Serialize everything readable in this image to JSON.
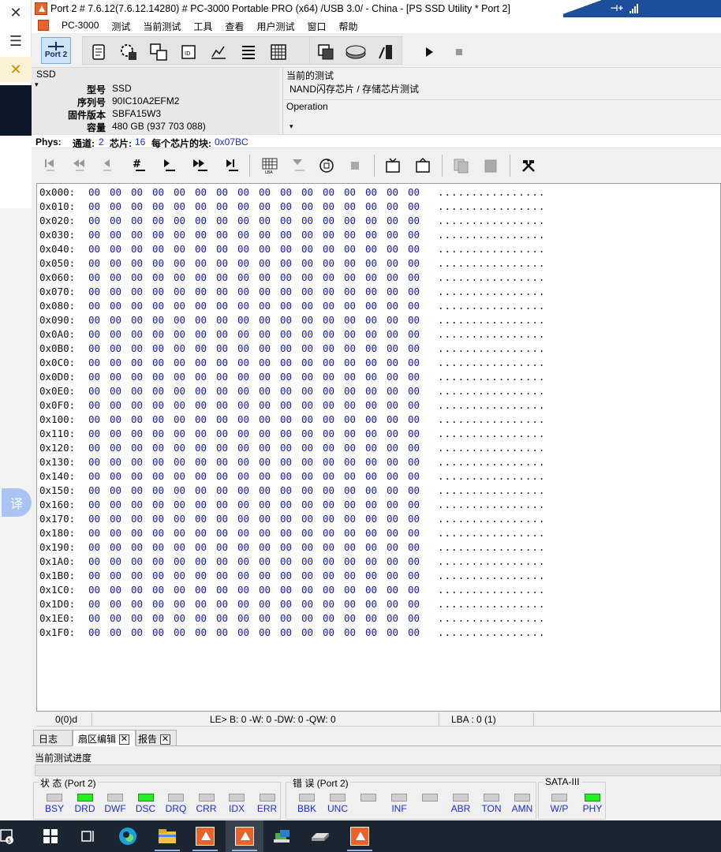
{
  "window": {
    "title": "Port 2 # 7.6.12(7.6.12.14280) # PC-3000 Portable PRO (x64) /USB 3.0/ - China - [PS SSD Utility * Port 2]"
  },
  "menu": {
    "items": [
      "PC-3000",
      "测试",
      "当前测试",
      "工具",
      "查看",
      "用户测试",
      "窗口",
      "帮助"
    ]
  },
  "toolbar": {
    "port_label": "Port 2"
  },
  "device": {
    "header": "SSD",
    "fields": [
      {
        "label": "型号",
        "value": "SSD"
      },
      {
        "label": "序列号",
        "value": "90IC10A2EFM2"
      },
      {
        "label": "固件版本",
        "value": "SBFA15W3"
      },
      {
        "label": "容量",
        "value": "480 GB (937 703 088)"
      }
    ]
  },
  "current_test": {
    "label": "当前的测试",
    "value": "NAND闪存芯片 / 存储芯片测试",
    "operation_label": "Operation"
  },
  "phys": {
    "label": "Phys:",
    "channels_label": "通道:",
    "channels": "2",
    "chips_label": "芯片:",
    "chips": "16",
    "blocks_label": "每个芯片的块:",
    "blocks": "0x07BC"
  },
  "hex": {
    "addresses": [
      "0x000:",
      "0x010:",
      "0x020:",
      "0x030:",
      "0x040:",
      "0x050:",
      "0x060:",
      "0x070:",
      "0x080:",
      "0x090:",
      "0x0A0:",
      "0x0B0:",
      "0x0C0:",
      "0x0D0:",
      "0x0E0:",
      "0x0F0:",
      "0x100:",
      "0x110:",
      "0x120:",
      "0x130:",
      "0x140:",
      "0x150:",
      "0x160:",
      "0x170:",
      "0x180:",
      "0x190:",
      "0x1A0:",
      "0x1B0:",
      "0x1C0:",
      "0x1D0:",
      "0x1E0:",
      "0x1F0:"
    ],
    "byte_value": "00",
    "bytes_per_row": 16,
    "ascii_row": "................"
  },
  "status": {
    "position": "0(0)d",
    "le": "LE> B: 0 -W: 0 -DW: 0 -QW: 0",
    "lba": "LBA : 0 (1)"
  },
  "tabs": [
    {
      "label": "日志",
      "closable": false
    },
    {
      "label": "扇区编辑",
      "closable": true,
      "active": true
    },
    {
      "label": "报告",
      "closable": true
    }
  ],
  "progress": {
    "label": "当前测试进度"
  },
  "leds": {
    "state_group": "状 态 (Port 2)",
    "error_group": "错 误 (Port 2)",
    "sata_group": "SATA-III",
    "state": [
      {
        "label": "BSY",
        "on": false
      },
      {
        "label": "DRD",
        "on": true
      },
      {
        "label": "DWF",
        "on": false
      },
      {
        "label": "DSC",
        "on": true
      },
      {
        "label": "DRQ",
        "on": false
      },
      {
        "label": "CRR",
        "on": false
      },
      {
        "label": "IDX",
        "on": false
      },
      {
        "label": "ERR",
        "on": false
      }
    ],
    "error": [
      {
        "label": "BBK",
        "on": false
      },
      {
        "label": "UNC",
        "on": false
      },
      {
        "label": "",
        "on": false
      },
      {
        "label": "INF",
        "on": false
      },
      {
        "label": "",
        "on": false
      },
      {
        "label": "ABR",
        "on": false
      },
      {
        "label": "TON",
        "on": false
      },
      {
        "label": "AMN",
        "on": false
      }
    ],
    "sata": [
      {
        "label": "W/P",
        "on": false
      },
      {
        "label": "PHY",
        "on": true
      }
    ]
  },
  "sidebar": {
    "translate_label": "译"
  },
  "taskbar": {
    "notification_count": "5"
  },
  "colors": {
    "led_on": "#22ee22",
    "hex_bytes": "#1a1aa8",
    "accent_blue": "#1d4e9c",
    "app_orange": "#e8622a"
  }
}
